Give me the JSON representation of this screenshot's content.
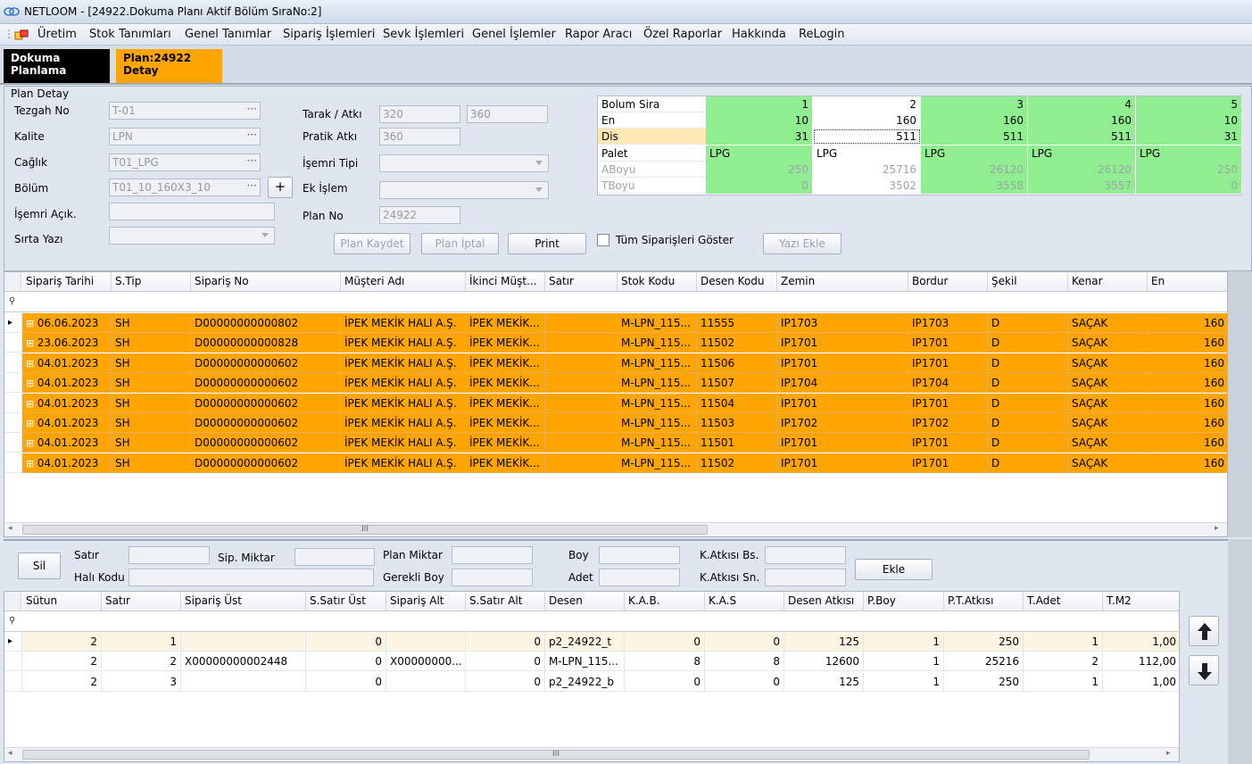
{
  "window": {
    "title": "NETLOOM - [24922.Dokuma Planı Aktif Bölüm SıraNo:2]"
  },
  "menu": [
    "Üretim",
    "Stok Tanımları",
    "Genel Tanımlar",
    "Sipariş İşlemleri",
    "Sevk İşlemleri",
    "Genel İşlemler",
    "Rapor Aracı",
    "Özel Raporlar",
    "Hakkında",
    "ReLogin"
  ],
  "tabs": {
    "tab1": "Dokuma\nPlanlama",
    "tab2": "Plan:24922\nDetay"
  },
  "plan": {
    "group_title": "Plan Detay",
    "tezgah_label": "Tezgah No",
    "tezgah_value": "T-01",
    "kalite_label": "Kalite",
    "kalite_value": "LPN",
    "caglik_label": "Cağlık",
    "caglik_value": "T01_LPG",
    "bolum_label": "Bölüm",
    "bolum_value": "T01_10_160X3_10",
    "isemri_acik_label": "İşemri Açık.",
    "sirta_label": "Sırta Yazı",
    "tarak_label": "Tarak / Atkı",
    "tarak_value1": "320",
    "tarak_value2": "360",
    "pratik_label": "Pratik Atkı",
    "pratik_value": "360",
    "isemri_tipi_label": "İşemri Tipi",
    "ek_islem_label": "Ek İşlem",
    "plan_no_label": "Plan No",
    "plan_no_value": "24922",
    "btn_kaydet": "Plan Kaydet",
    "btn_iptal": "Plan İptal",
    "btn_print": "Print",
    "tum_siparis": "Tüm Siparişleri Göster",
    "btn_yazi": "Yazı Ekle",
    "plus": "+"
  },
  "bolum_table": {
    "rows": [
      {
        "label": "Bolum Sira",
        "values": [
          "1",
          "2",
          "3",
          "4",
          "5"
        ]
      },
      {
        "label": "En",
        "values": [
          "10",
          "160",
          "160",
          "160",
          "10"
        ]
      },
      {
        "label": "Dis",
        "values": [
          "31",
          "511",
          "511",
          "511",
          "31"
        ]
      },
      {
        "label": "Palet",
        "values": [
          "LPG",
          "LPG",
          "LPG",
          "LPG",
          "LPG"
        ]
      },
      {
        "label": "ABoyu",
        "values": [
          "250",
          "25716",
          "26120",
          "26120",
          "250"
        ]
      },
      {
        "label": "TBoyu",
        "values": [
          "0",
          "3502",
          "3558",
          "3557",
          "0"
        ]
      }
    ]
  },
  "orders": {
    "headers": [
      "Sipariş Tarihi",
      "S.Tip",
      "Sipariş No",
      "Müşteri Adı",
      "İkinci Müşt...",
      "Satır",
      "Stok Kodu",
      "Desen Kodu",
      "Zemin",
      "Bordur",
      "Şekil",
      "Kenar",
      "En"
    ],
    "rows": [
      [
        "06.06.2023",
        "SH",
        "D00000000000802",
        "İPEK MEKİK HALI A.Ş.",
        "İPEK MEKİK...",
        "",
        "M-LPN_115...",
        "11555",
        "IP1703",
        "IP1703",
        "D",
        "SAÇAK",
        "160"
      ],
      [
        "23.06.2023",
        "SH",
        "D00000000000828",
        "İPEK MEKİK HALI A.Ş.",
        "İPEK MEKİK...",
        "",
        "M-LPN_115...",
        "11502",
        "IP1701",
        "IP1701",
        "D",
        "SAÇAK",
        "160"
      ],
      [
        "04.01.2023",
        "SH",
        "D00000000000602",
        "İPEK MEKİK HALI A.Ş.",
        "İPEK MEKİK...",
        "",
        "M-LPN_115...",
        "11506",
        "IP1701",
        "IP1701",
        "D",
        "SAÇAK",
        "160"
      ],
      [
        "04.01.2023",
        "SH",
        "D00000000000602",
        "İPEK MEKİK HALI A.Ş.",
        "İPEK MEKİK...",
        "",
        "M-LPN_115...",
        "11507",
        "IP1704",
        "IP1704",
        "D",
        "SAÇAK",
        "160"
      ],
      [
        "04.01.2023",
        "SH",
        "D00000000000602",
        "İPEK MEKİK HALI A.Ş.",
        "İPEK MEKİK...",
        "",
        "M-LPN_115...",
        "11504",
        "IP1701",
        "IP1701",
        "D",
        "SAÇAK",
        "160"
      ],
      [
        "04.01.2023",
        "SH",
        "D00000000000602",
        "İPEK MEKİK HALI A.Ş.",
        "İPEK MEKİK...",
        "",
        "M-LPN_115...",
        "11503",
        "IP1702",
        "IP1702",
        "D",
        "SAÇAK",
        "160"
      ],
      [
        "04.01.2023",
        "SH",
        "D00000000000602",
        "İPEK MEKİK HALI A.Ş.",
        "İPEK MEKİK...",
        "",
        "M-LPN_115...",
        "11501",
        "IP1701",
        "IP1701",
        "D",
        "SAÇAK",
        "160"
      ],
      [
        "04.01.2023",
        "SH",
        "D00000000000602",
        "İPEK MEKİK HALI A.Ş.",
        "İPEK MEKİK...",
        "",
        "M-LPN_115...",
        "11502",
        "IP1701",
        "IP1701",
        "D",
        "SAÇAK",
        "160"
      ]
    ]
  },
  "detail_form": {
    "btn_sil": "Sil",
    "satir": "Satır",
    "hali_kodu": "Halı Kodu",
    "sip_miktar": "Sip. Miktar",
    "plan_miktar": "Plan Miktar",
    "gerekli_boy": "Gerekli Boy",
    "boy": "Boy",
    "adet": "Adet",
    "katkisi_bs": "K.Atkısı Bs.",
    "katkisi_sn": "K.Atkısı Sn.",
    "btn_ekle": "Ekle"
  },
  "details": {
    "headers": [
      "Sütun",
      "Satır",
      "Sipariş Üst",
      "S.Satır Üst",
      "Sipariş Alt",
      "S.Satır Alt",
      "Desen",
      "K.A.B.",
      "K.A.S",
      "Desen Atkısı",
      "P.Boy",
      "P.T.Atkısı",
      "T.Adet",
      "T.M2"
    ],
    "rows": [
      [
        "2",
        "1",
        "",
        "0",
        "",
        "0",
        "p2_24922_t",
        "0",
        "0",
        "125",
        "1",
        "250",
        "1",
        "1,00"
      ],
      [
        "2",
        "2",
        "X00000000002448",
        "0",
        "X00000000...",
        "0",
        "M-LPN_115...",
        "8",
        "8",
        "12600",
        "1",
        "25216",
        "2",
        "112,00"
      ],
      [
        "2",
        "3",
        "",
        "0",
        "",
        "0",
        "p2_24922_b",
        "0",
        "0",
        "125",
        "1",
        "250",
        "1",
        "1,00"
      ]
    ]
  },
  "scroll_mid": "III",
  "colors": {
    "orange": "#ffa500",
    "green": "#90ee90",
    "tab_active": "#ffa500",
    "tab_dark": "#000000"
  }
}
